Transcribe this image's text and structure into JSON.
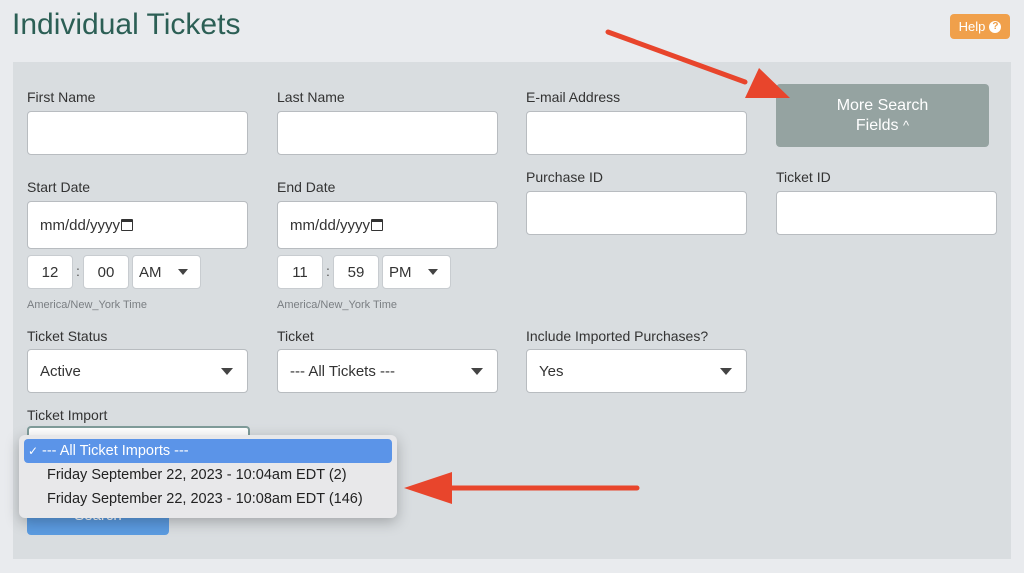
{
  "header": {
    "title": "Individual Tickets",
    "help_label": "Help",
    "help_icon": "?"
  },
  "form": {
    "first_name_label": "First Name",
    "last_name_label": "Last Name",
    "email_label": "E-mail Address",
    "more_fields_line1": "More Search",
    "more_fields_line2": "Fields",
    "more_fields_icon": "^",
    "start_date_label": "Start Date",
    "end_date_label": "End Date",
    "purchase_id_label": "Purchase ID",
    "ticket_id_label": "Ticket ID",
    "date_placeholder": "mm/dd/yyyy",
    "start_hour": "12",
    "start_minute": "00",
    "start_ampm": "AM",
    "end_hour": "11",
    "end_minute": "59",
    "end_ampm": "PM",
    "colon": ":",
    "timezone": "America/New_York Time",
    "ticket_status_label": "Ticket Status",
    "ticket_status_value": "Active",
    "ticket_label": "Ticket",
    "ticket_value": "--- All Tickets ---",
    "imported_label": "Include Imported Purchases?",
    "imported_value": "Yes",
    "ticket_import_label": "Ticket Import",
    "search_label": "Search"
  },
  "dropdown": {
    "check_mark": "✓",
    "options": [
      "--- All Ticket Imports ---",
      "Friday September 22, 2023 - 10:04am EDT (2)",
      "Friday September 22, 2023 - 10:08am EDT (146)"
    ]
  },
  "colors": {
    "title": "#2c5f55",
    "help": "#f0a04b",
    "more_button": "#95a3a1",
    "search_button": "#5b9be0",
    "selected_option": "#5b94e8",
    "arrow": "#e8452c"
  }
}
